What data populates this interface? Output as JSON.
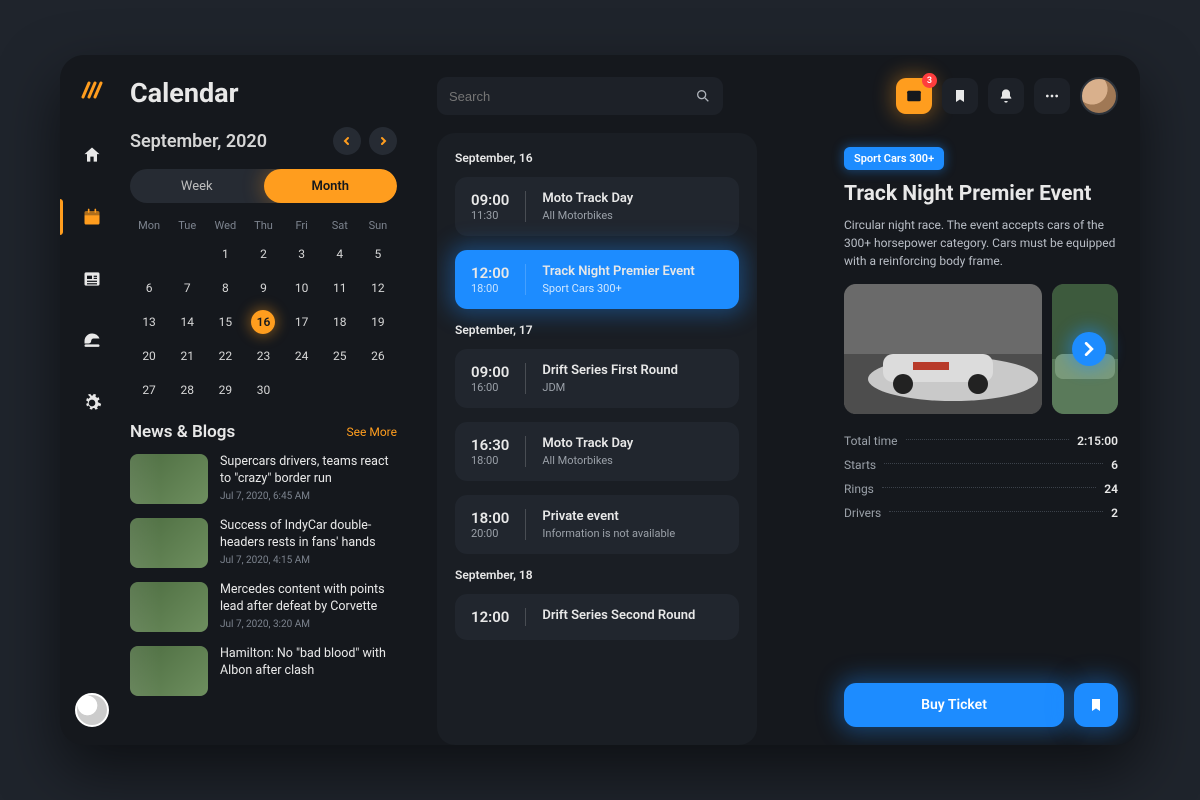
{
  "sidebar": {
    "items": [
      {
        "name": "home"
      },
      {
        "name": "calendar",
        "active": true
      },
      {
        "name": "news"
      },
      {
        "name": "helmet"
      },
      {
        "name": "settings"
      }
    ],
    "bottom": {
      "name": "support-avatar"
    }
  },
  "page": {
    "title": "Calendar",
    "month_label": "September, 2020",
    "view_toggle": {
      "week": "Week",
      "month": "Month",
      "active": "month"
    }
  },
  "calendar": {
    "dow": [
      "Mon",
      "Tue",
      "Wed",
      "Thu",
      "Fri",
      "Sat",
      "Sun"
    ],
    "weeks": [
      [
        "",
        "1",
        "2",
        "3",
        "4",
        "5"
      ],
      [
        "6",
        "7",
        "8",
        "9",
        "10",
        "11",
        "12"
      ],
      [
        "13",
        "14",
        "15",
        "16",
        "17",
        "18",
        "19"
      ],
      [
        "20",
        "21",
        "22",
        "23",
        "24",
        "25",
        "26"
      ],
      [
        "27",
        "28",
        "29",
        "30",
        "",
        "",
        ""
      ]
    ],
    "selected": "16"
  },
  "news": {
    "heading": "News & Blogs",
    "see_more": "See More",
    "items": [
      {
        "title": "Supercars drivers, teams react to \"crazy\" border run",
        "date": "Jul 7, 2020, 6:45 AM"
      },
      {
        "title": "Success of IndyCar double-headers rests in fans' hands",
        "date": "Jul 7, 2020, 4:15 AM"
      },
      {
        "title": "Mercedes content with points lead after defeat by Corvette",
        "date": "Jul 7, 2020, 3:20 AM"
      },
      {
        "title": "Hamilton: No \"bad blood\" with Albon after clash",
        "date": ""
      }
    ]
  },
  "search": {
    "placeholder": "Search"
  },
  "header_icons": {
    "mail_badge": "3"
  },
  "events": {
    "groups": [
      {
        "heading": "September, 16",
        "items": [
          {
            "start": "09:00",
            "end": "11:30",
            "title": "Moto Track Day",
            "subtitle": "All Motorbikes",
            "selected": false
          },
          {
            "start": "12:00",
            "end": "18:00",
            "title": "Track Night Premier Event",
            "subtitle": "Sport Cars 300+",
            "selected": true
          }
        ]
      },
      {
        "heading": "September, 17",
        "items": [
          {
            "start": "09:00",
            "end": "16:00",
            "title": "Drift Series First Round",
            "subtitle": "JDM",
            "selected": false
          },
          {
            "start": "16:30",
            "end": "18:00",
            "title": "Moto Track Day",
            "subtitle": "All Motorbikes",
            "selected": false
          },
          {
            "start": "18:00",
            "end": "20:00",
            "title": "Private event",
            "subtitle": "Information is not available",
            "selected": false
          }
        ]
      },
      {
        "heading": "September, 18",
        "items": [
          {
            "start": "12:00",
            "end": "",
            "title": "Drift Series Second Round",
            "subtitle": "",
            "selected": false
          }
        ]
      }
    ]
  },
  "detail": {
    "tag": "Sport Cars 300+",
    "title": "Track Night Premier Event",
    "description": "Circular night race. The event accepts cars of the 300+ horsepower category. Cars must be equipped with a reinforcing body frame.",
    "stats": [
      {
        "k": "Total time",
        "v": "2:15:00"
      },
      {
        "k": "Starts",
        "v": "6"
      },
      {
        "k": "Rings",
        "v": "24"
      },
      {
        "k": "Drivers",
        "v": "2"
      }
    ],
    "buy_label": "Buy Ticket"
  }
}
